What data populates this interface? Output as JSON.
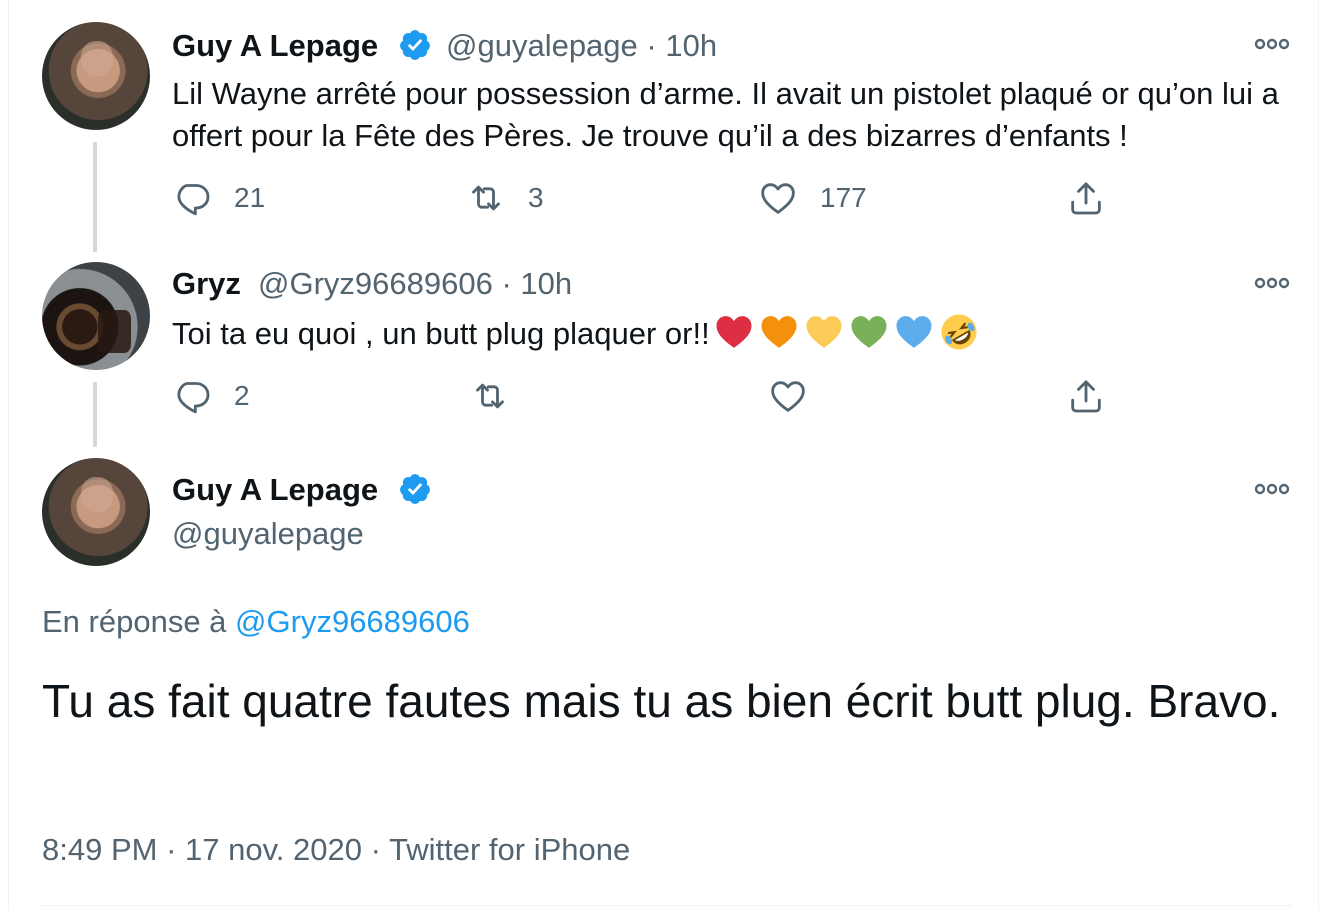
{
  "tweets": [
    {
      "name": "Guy A Lepage",
      "handle": "@guyalepage",
      "separator": "·",
      "time": "10h",
      "text": "Lil Wayne arrêté pour possession d’arme. Il avait un pistolet plaqué or qu’on lui a offert pour la Fête des Pères. Je trouve qu’il a des bizarres d’enfants !",
      "replies": "21",
      "retweets": "3",
      "likes": "177"
    },
    {
      "name": "Gryz",
      "handle": "@Gryz96689606",
      "separator": "·",
      "time": "10h",
      "text": "Toi ta eu quoi , un butt plug plaquer or!!",
      "emojis": [
        "red-heart",
        "orange-heart",
        "yellow-heart",
        "green-heart",
        "blue-heart",
        "rolling-laughing-face"
      ],
      "replies": "2"
    }
  ],
  "main": {
    "name": "Guy A Lepage",
    "handle": "@guyalepage",
    "reply_prefix": "En réponse à",
    "reply_mention": "@Gryz96689606",
    "text": "Tu as fait quatre fautes mais tu as bien écrit butt plug. Bravo.",
    "time": "8:49 PM",
    "date": "17 nov. 2020",
    "source": "Twitter for iPhone",
    "separator": "·"
  },
  "colors": {
    "accent": "#1d9bf0",
    "secondary_text": "#536471",
    "heart_red": "#dd2e44",
    "heart_orange": "#f4900c",
    "heart_yellow": "#fdcb58",
    "heart_green": "#78b159",
    "heart_blue": "#5dadec"
  }
}
